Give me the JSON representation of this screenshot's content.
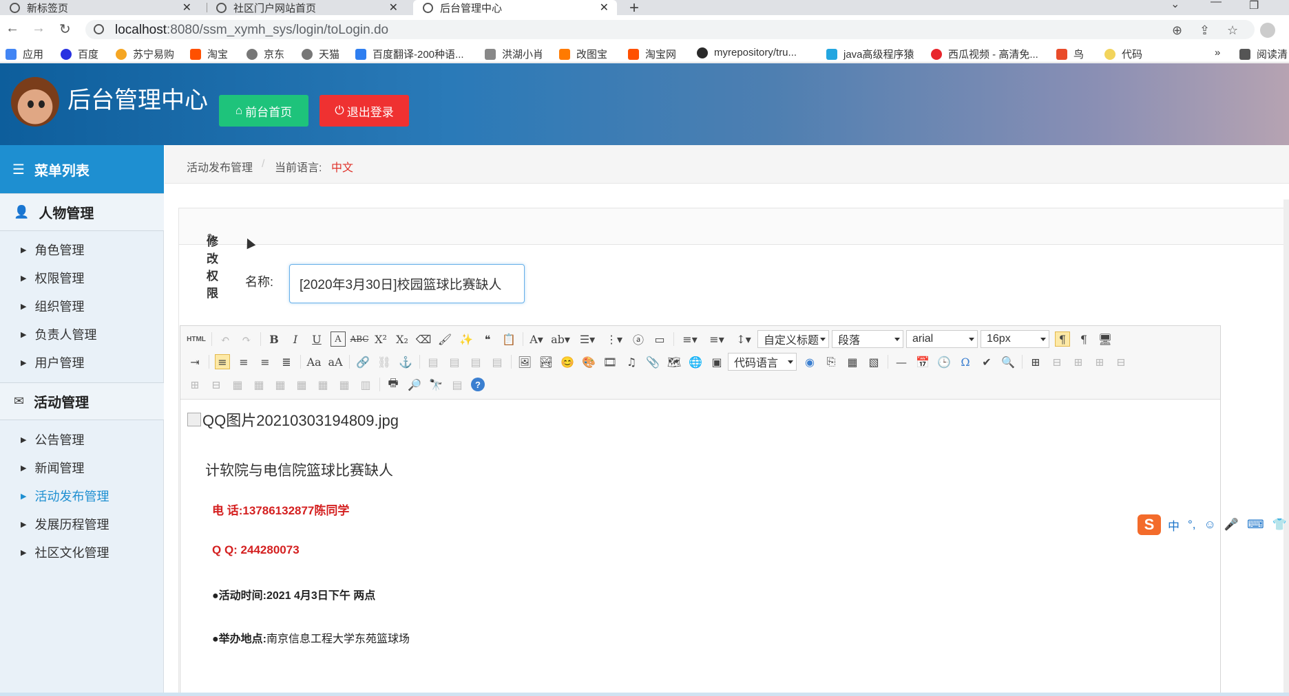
{
  "browser": {
    "tabs": [
      {
        "label": "新标签页",
        "active": false
      },
      {
        "label": "社区门户网站首页",
        "active": false
      },
      {
        "label": "后台管理中心",
        "active": true
      }
    ],
    "url_host": "localhost",
    "url_rest": ":8080/ssm_xymh_sys/login/toLogin.do",
    "bookmarks": [
      {
        "label": "应用",
        "color": "#4285f4"
      },
      {
        "label": "百度",
        "color": "#2932e1"
      },
      {
        "label": "苏宁易购",
        "color": "#f5a623"
      },
      {
        "label": "淘宝",
        "color": "#ff5000"
      },
      {
        "label": "京东",
        "color": "#777777"
      },
      {
        "label": "天猫",
        "color": "#777777"
      },
      {
        "label": "百度翻译-200种语...",
        "color": "#2e7ef0"
      },
      {
        "label": "洪湖小肖",
        "color": "#888888"
      },
      {
        "label": "改图宝",
        "color": "#ff7a00"
      },
      {
        "label": "淘宝网",
        "color": "#ff5000"
      },
      {
        "label": "myrepository/tru...",
        "color": "#2a2a2a"
      },
      {
        "label": "java高级程序猿",
        "color": "#23a6e0"
      },
      {
        "label": "西瓜视频 - 高清免...",
        "color": "#e8262c"
      },
      {
        "label": "鸟",
        "color": "#e94b2a"
      },
      {
        "label": "代码",
        "color": "#f2d45c"
      },
      {
        "label": "阅读清",
        "color": "#555555"
      }
    ],
    "more_bookmarks": "»"
  },
  "header": {
    "title": "后台管理中心",
    "home_button": "前台首页",
    "logout_button": "退出登录"
  },
  "sidebar": {
    "title": "菜单列表",
    "groups": [
      {
        "label": "人物管理",
        "items": [
          "角色管理",
          "权限管理",
          "组织管理",
          "负责人管理",
          "用户管理"
        ]
      },
      {
        "label": "活动管理",
        "items": [
          "公告管理",
          "新闻管理",
          "活动发布管理",
          "发展历程管理",
          "社区文化管理"
        ]
      }
    ],
    "active_item": "活动发布管理"
  },
  "breadcrumb": {
    "section": "活动发布管理",
    "separator": "/",
    "lang_label": "当前语言:",
    "lang_value": "中文"
  },
  "form": {
    "panel_title": "修改权限",
    "name_label": "名称:",
    "name_value": "[2020年3月30日]校园篮球比赛缺人"
  },
  "editor": {
    "custom_heading": "自定义标题",
    "paragraph": "段落",
    "font_family": "arial",
    "font_size": "16px",
    "code_lang": "代码语言",
    "html_label": "HTML",
    "content": {
      "image_alt": "QQ图片20210303194809.jpg",
      "headline": "计软院与电信院篮球比赛缺人",
      "phone": "电 话:13786132877陈同学",
      "qq": "Q Q: 244280073",
      "time": "●活动时间:2021 4月3日下午 两点",
      "place_label": "●举办地点:",
      "place_value": "南京信息工程大学东苑篮球场"
    }
  },
  "ime": {
    "items": [
      "中",
      "°,",
      "☺",
      "🎤",
      "⌨",
      "👕"
    ]
  }
}
